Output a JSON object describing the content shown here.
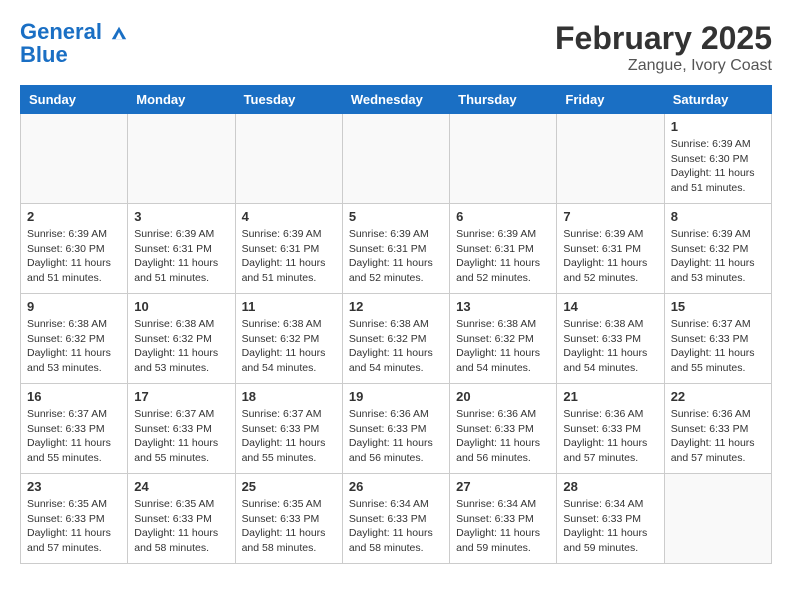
{
  "header": {
    "logo_line1": "General",
    "logo_line2": "Blue",
    "month_title": "February 2025",
    "location": "Zangue, Ivory Coast"
  },
  "weekdays": [
    "Sunday",
    "Monday",
    "Tuesday",
    "Wednesday",
    "Thursday",
    "Friday",
    "Saturday"
  ],
  "weeks": [
    [
      {
        "day": "",
        "info": ""
      },
      {
        "day": "",
        "info": ""
      },
      {
        "day": "",
        "info": ""
      },
      {
        "day": "",
        "info": ""
      },
      {
        "day": "",
        "info": ""
      },
      {
        "day": "",
        "info": ""
      },
      {
        "day": "1",
        "info": "Sunrise: 6:39 AM\nSunset: 6:30 PM\nDaylight: 11 hours and 51 minutes."
      }
    ],
    [
      {
        "day": "2",
        "info": "Sunrise: 6:39 AM\nSunset: 6:30 PM\nDaylight: 11 hours and 51 minutes."
      },
      {
        "day": "3",
        "info": "Sunrise: 6:39 AM\nSunset: 6:31 PM\nDaylight: 11 hours and 51 minutes."
      },
      {
        "day": "4",
        "info": "Sunrise: 6:39 AM\nSunset: 6:31 PM\nDaylight: 11 hours and 51 minutes."
      },
      {
        "day": "5",
        "info": "Sunrise: 6:39 AM\nSunset: 6:31 PM\nDaylight: 11 hours and 52 minutes."
      },
      {
        "day": "6",
        "info": "Sunrise: 6:39 AM\nSunset: 6:31 PM\nDaylight: 11 hours and 52 minutes."
      },
      {
        "day": "7",
        "info": "Sunrise: 6:39 AM\nSunset: 6:31 PM\nDaylight: 11 hours and 52 minutes."
      },
      {
        "day": "8",
        "info": "Sunrise: 6:39 AM\nSunset: 6:32 PM\nDaylight: 11 hours and 53 minutes."
      }
    ],
    [
      {
        "day": "9",
        "info": "Sunrise: 6:38 AM\nSunset: 6:32 PM\nDaylight: 11 hours and 53 minutes."
      },
      {
        "day": "10",
        "info": "Sunrise: 6:38 AM\nSunset: 6:32 PM\nDaylight: 11 hours and 53 minutes."
      },
      {
        "day": "11",
        "info": "Sunrise: 6:38 AM\nSunset: 6:32 PM\nDaylight: 11 hours and 54 minutes."
      },
      {
        "day": "12",
        "info": "Sunrise: 6:38 AM\nSunset: 6:32 PM\nDaylight: 11 hours and 54 minutes."
      },
      {
        "day": "13",
        "info": "Sunrise: 6:38 AM\nSunset: 6:32 PM\nDaylight: 11 hours and 54 minutes."
      },
      {
        "day": "14",
        "info": "Sunrise: 6:38 AM\nSunset: 6:33 PM\nDaylight: 11 hours and 54 minutes."
      },
      {
        "day": "15",
        "info": "Sunrise: 6:37 AM\nSunset: 6:33 PM\nDaylight: 11 hours and 55 minutes."
      }
    ],
    [
      {
        "day": "16",
        "info": "Sunrise: 6:37 AM\nSunset: 6:33 PM\nDaylight: 11 hours and 55 minutes."
      },
      {
        "day": "17",
        "info": "Sunrise: 6:37 AM\nSunset: 6:33 PM\nDaylight: 11 hours and 55 minutes."
      },
      {
        "day": "18",
        "info": "Sunrise: 6:37 AM\nSunset: 6:33 PM\nDaylight: 11 hours and 55 minutes."
      },
      {
        "day": "19",
        "info": "Sunrise: 6:36 AM\nSunset: 6:33 PM\nDaylight: 11 hours and 56 minutes."
      },
      {
        "day": "20",
        "info": "Sunrise: 6:36 AM\nSunset: 6:33 PM\nDaylight: 11 hours and 56 minutes."
      },
      {
        "day": "21",
        "info": "Sunrise: 6:36 AM\nSunset: 6:33 PM\nDaylight: 11 hours and 57 minutes."
      },
      {
        "day": "22",
        "info": "Sunrise: 6:36 AM\nSunset: 6:33 PM\nDaylight: 11 hours and 57 minutes."
      }
    ],
    [
      {
        "day": "23",
        "info": "Sunrise: 6:35 AM\nSunset: 6:33 PM\nDaylight: 11 hours and 57 minutes."
      },
      {
        "day": "24",
        "info": "Sunrise: 6:35 AM\nSunset: 6:33 PM\nDaylight: 11 hours and 58 minutes."
      },
      {
        "day": "25",
        "info": "Sunrise: 6:35 AM\nSunset: 6:33 PM\nDaylight: 11 hours and 58 minutes."
      },
      {
        "day": "26",
        "info": "Sunrise: 6:34 AM\nSunset: 6:33 PM\nDaylight: 11 hours and 58 minutes."
      },
      {
        "day": "27",
        "info": "Sunrise: 6:34 AM\nSunset: 6:33 PM\nDaylight: 11 hours and 59 minutes."
      },
      {
        "day": "28",
        "info": "Sunrise: 6:34 AM\nSunset: 6:33 PM\nDaylight: 11 hours and 59 minutes."
      },
      {
        "day": "",
        "info": ""
      }
    ]
  ]
}
